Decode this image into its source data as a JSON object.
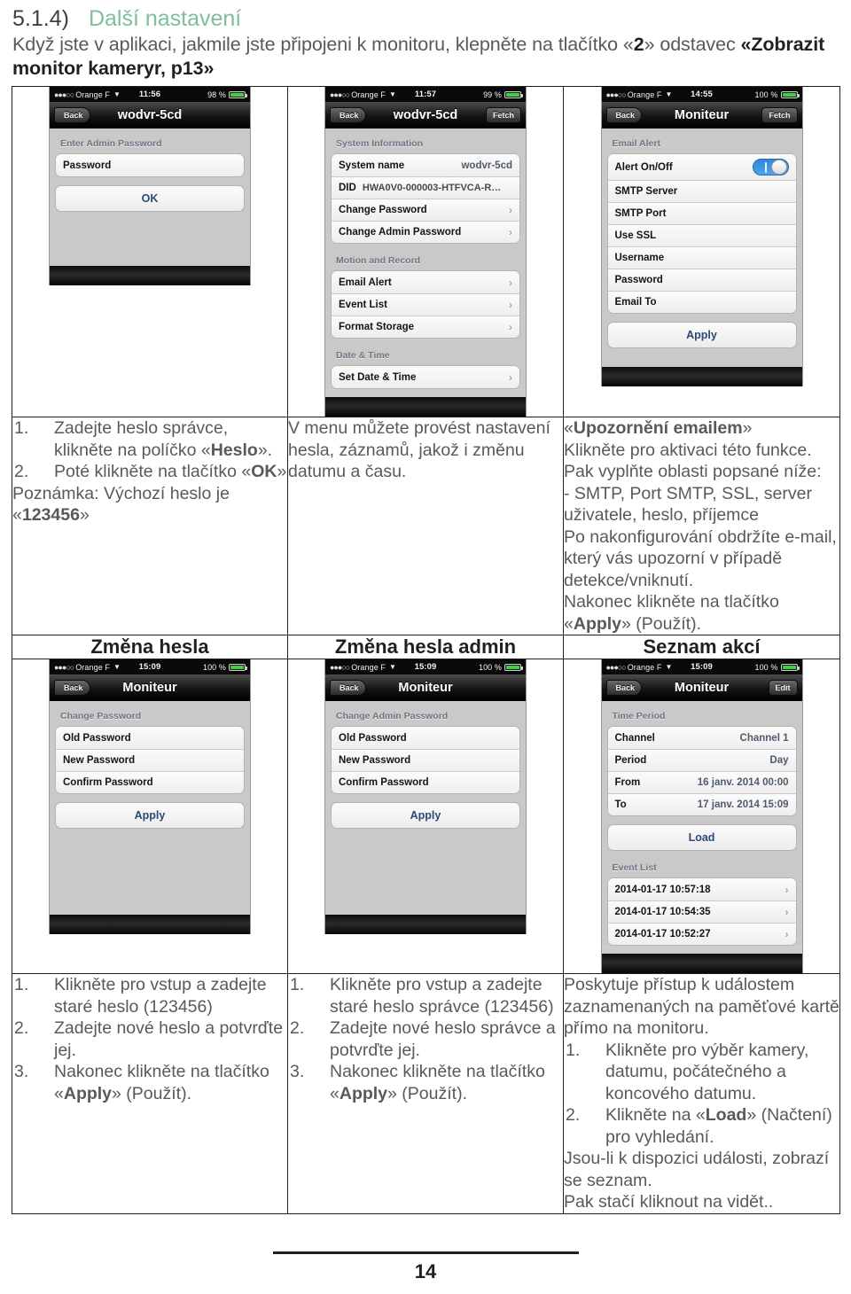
{
  "header": {
    "section_number": "5.1.4)",
    "section_title": "Další nastavení",
    "intro_part1": "Když jste v aplikaci, jakmile jste připojeni k monitoru, klepněte na tlačítko «",
    "intro_bold1": "2",
    "intro_part2": "» odstavec ",
    "intro_bold2": "«Zobrazit monitor kameryr, p13»"
  },
  "footer": {
    "page_number": "14"
  },
  "phones": {
    "p1": {
      "status": {
        "carrier": "Orange F",
        "time": "11:56",
        "battery_pct": "98 %",
        "wifi_icon": "wifi-icon",
        "signal_icon": "signal-dots-icon"
      },
      "nav": {
        "back": "Back",
        "title": "wodvr-5cd",
        "right": ""
      },
      "group_title": "Enter Admin Password",
      "field": "Password",
      "button": "OK"
    },
    "p2": {
      "status": {
        "carrier": "Orange F",
        "time": "11:57",
        "battery_pct": "99 %",
        "wifi_icon": "wifi-icon",
        "signal_icon": "signal-dots-icon"
      },
      "nav": {
        "back": "Back",
        "title": "wodvr-5cd",
        "right": "Fetch"
      },
      "g1_title": "System Information",
      "rows1": [
        {
          "label": "System name",
          "value": "wodvr-5cd",
          "chevron": false
        },
        {
          "label": "DID",
          "value": "HWA0V0-000003-HTFVCA-R…",
          "chevron": false
        },
        {
          "label": "Change Password",
          "value": "",
          "chevron": true
        },
        {
          "label": "Change Admin Password",
          "value": "",
          "chevron": true
        }
      ],
      "g2_title": "Motion and Record",
      "rows2": [
        {
          "label": "Email Alert",
          "value": "",
          "chevron": true
        },
        {
          "label": "Event List",
          "value": "",
          "chevron": true
        },
        {
          "label": "Format Storage",
          "value": "",
          "chevron": true
        }
      ],
      "g3_title": "Date & Time",
      "rows3": [
        {
          "label": "Set Date & Time",
          "value": "",
          "chevron": true
        }
      ]
    },
    "p3": {
      "status": {
        "carrier": "Orange F",
        "time": "14:55",
        "battery_pct": "100 %",
        "wifi_icon": "wifi-icon",
        "signal_icon": "signal-dots-icon"
      },
      "nav": {
        "back": "Back",
        "title": "Moniteur",
        "right": "Fetch"
      },
      "group_title": "Email Alert",
      "rows": [
        {
          "label": "Alert On/Off",
          "toggle": true,
          "toggle_state": "on"
        },
        {
          "label": "SMTP Server",
          "toggle": false
        },
        {
          "label": "SMTP Port",
          "toggle": false
        },
        {
          "label": "Use SSL",
          "toggle": false
        },
        {
          "label": "Username",
          "toggle": false
        },
        {
          "label": "Password",
          "toggle": false
        },
        {
          "label": "Email To",
          "toggle": false
        }
      ],
      "button": "Apply"
    },
    "p4": {
      "status": {
        "carrier": "Orange F",
        "time": "15:09",
        "battery_pct": "100 %",
        "wifi_icon": "wifi-icon",
        "signal_icon": "signal-dots-icon"
      },
      "nav": {
        "back": "Back",
        "title": "Moniteur",
        "right": ""
      },
      "group_title": "Change Password",
      "rows": [
        "Old Password",
        "New Password",
        "Confirm Password"
      ],
      "button": "Apply"
    },
    "p5": {
      "status": {
        "carrier": "Orange F",
        "time": "15:09",
        "battery_pct": "100 %",
        "wifi_icon": "wifi-icon",
        "signal_icon": "signal-dots-icon"
      },
      "nav": {
        "back": "Back",
        "title": "Moniteur",
        "right": ""
      },
      "group_title": "Change Admin Password",
      "rows": [
        "Old Password",
        "New Password",
        "Confirm Password"
      ],
      "button": "Apply"
    },
    "p6": {
      "status": {
        "carrier": "Orange F",
        "time": "15:09",
        "battery_pct": "100 %",
        "wifi_icon": "wifi-icon",
        "signal_icon": "signal-dots-icon"
      },
      "nav": {
        "back": "Back",
        "title": "Moniteur",
        "right": "Edit"
      },
      "g1_title": "Time Period",
      "rows1": [
        {
          "label": "Channel",
          "value": "Channel 1"
        },
        {
          "label": "Period",
          "value": "Day"
        },
        {
          "label": "From",
          "value": "16 janv. 2014 00:00"
        },
        {
          "label": "To",
          "value": "17 janv. 2014 15:09"
        }
      ],
      "button": "Load",
      "g2_title": "Event List",
      "events": [
        "2014-01-17 10:57:18",
        "2014-01-17 10:54:35",
        "2014-01-17 10:52:27"
      ]
    }
  },
  "row1_text": {
    "c1": {
      "step1_num": "1.",
      "step1_a": "Zadejte heslo správce, klikněte na políčko «",
      "step1_b": "Heslo",
      "step1_c": "».",
      "step2_num": "2.",
      "step2_a": "Poté klikněte na tlačítko «",
      "step2_b": "OK",
      "step2_c": "»",
      "note_a": "Poznámka: Výchozí heslo je «",
      "note_b": "123456",
      "note_c": "»"
    },
    "c2": {
      "text": "V menu můžete provést nastavení hesla, záznamů, jakož i změnu datumu a času."
    },
    "c3": {
      "title_a": "«",
      "title_b": "Upozornění emailem",
      "title_c": "»",
      "line1": "Klikněte pro aktivaci této funkce.",
      "line2": "Pak vyplňte oblasti popsané níže:",
      "line3": "- SMTP, Port SMTP, SSL, server uživatele, heslo, příjemce",
      "line4": "Po nakonfigurování obdržíte e-mail, který vás upozorní v případě detekce/vniknutí.",
      "line5_a": "Nakonec klikněte na tlačítko «",
      "line5_b": "Apply",
      "line5_c": "» (Použít)."
    }
  },
  "row2_headers": {
    "c1": "Změna hesla",
    "c2": "Změna hesla admin",
    "c3": "Seznam akcí"
  },
  "row2_text": {
    "c1": {
      "s1n": "1.",
      "s1": "Klikněte pro vstup a zadejte staré heslo (123456)",
      "s2n": "2.",
      "s2": "Zadejte nové heslo a potvrďte jej.",
      "s3n": "3.",
      "s3a": "Nakonec klikněte na tlačítko «",
      "s3b": "Apply",
      "s3c": "» (Použít)."
    },
    "c2": {
      "s1n": "1.",
      "s1": "Klikněte pro vstup a zadejte staré heslo správce (123456)",
      "s2n": "2.",
      "s2": "Zadejte nové heslo správce a potvrďte jej.",
      "s3n": "3.",
      "s3a": "Nakonec klikněte na tlačítko «",
      "s3b": "Apply",
      "s3c": "» (Použít)."
    },
    "c3": {
      "intro": "Poskytuje přístup k událostem zaznamenaných na paměťové kartě přímo na monitoru.",
      "s1n": "1.",
      "s1": "Klikněte pro výběr kamery, datumu, počátečného a koncového datumu.",
      "s2n": "2.",
      "s2a": "Klikněte na «",
      "s2b": "Load",
      "s2c": "» (Načtení) pro vyhledání.",
      "out1": "Jsou-li k dispozici události, zobrazí se seznam.",
      "out2": "Pak stačí kliknout na vidět.."
    }
  },
  "colors": {
    "accent_green": "#7fbf9a",
    "body_gray": "#58595b",
    "ios_blue": "#2b4a73"
  }
}
